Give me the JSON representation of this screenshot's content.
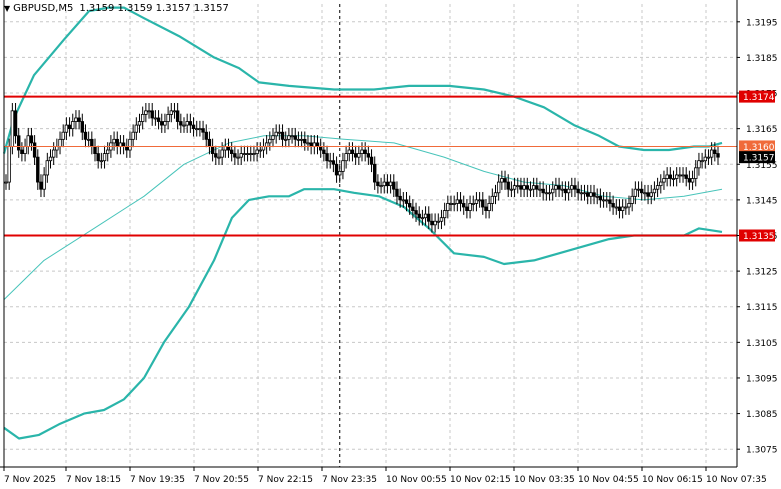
{
  "header": {
    "symbol": "GBPUSD,M5",
    "ohlc": "1.3159 1.3159 1.3157 1.3157"
  },
  "colors": {
    "background": "#ffffff",
    "grid": "#c8c8c8",
    "bollinger": "#2ab5aa",
    "middle_band": "#48c4ba",
    "level_strong": "#e00000",
    "level_thin": "#f06a3a",
    "candle": "#000000",
    "price_badge": "#000000"
  },
  "chart_data": {
    "type": "candlestick",
    "ylim": [
      1.307,
      1.32
    ],
    "y_ticks": [
      "1.3195",
      "1.3185",
      "1.3175",
      "1.3165",
      "1.3155",
      "1.3145",
      "1.3135",
      "1.3125",
      "1.3115",
      "1.3105",
      "1.3095",
      "1.3085",
      "1.3075"
    ],
    "x_ticks": [
      "7 Nov 2025",
      "7 Nov 18:15",
      "7 Nov 19:35",
      "7 Nov 20:55",
      "7 Nov 22:15",
      "7 Nov 23:35",
      "10 Nov 00:55",
      "10 Nov 02:15",
      "10 Nov 03:35",
      "10 Nov 04:55",
      "10 Nov 06:15",
      "10 Nov 07:35"
    ],
    "levels": [
      {
        "value": 1.3174,
        "label": "1.3174",
        "style": "strong"
      },
      {
        "value": 1.316,
        "label": "1.3160",
        "style": "thin"
      },
      {
        "value": 1.3135,
        "label": "1.3135",
        "style": "strong"
      }
    ],
    "current_price": {
      "value": 1.3157,
      "label": "1.3157"
    },
    "session_break_index": 105,
    "closes": [
      1.315,
      1.316,
      1.317,
      1.3163,
      1.3159,
      1.3158,
      1.316,
      1.3163,
      1.3161,
      1.3157,
      1.315,
      1.3148,
      1.3152,
      1.3156,
      1.3157,
      1.3159,
      1.316,
      1.3162,
      1.3164,
      1.3166,
      1.3165,
      1.3167,
      1.3168,
      1.3167,
      1.3164,
      1.3162,
      1.3162,
      1.316,
      1.3158,
      1.3156,
      1.3156,
      1.3158,
      1.3159,
      1.3161,
      1.3162,
      1.316,
      1.3161,
      1.316,
      1.3159,
      1.3162,
      1.3164,
      1.3166,
      1.3167,
      1.3169,
      1.317,
      1.317,
      1.3168,
      1.3168,
      1.3167,
      1.3166,
      1.3167,
      1.3169,
      1.317,
      1.317,
      1.3167,
      1.3166,
      1.3166,
      1.3167,
      1.3166,
      1.3165,
      1.3165,
      1.3165,
      1.3164,
      1.3162,
      1.316,
      1.3158,
      1.3157,
      1.3157,
      1.3159,
      1.316,
      1.3159,
      1.3158,
      1.3157,
      1.3157,
      1.3158,
      1.3158,
      1.3158,
      1.3158,
      1.3158,
      1.3159,
      1.3159,
      1.316,
      1.3161,
      1.3162,
      1.3163,
      1.3164,
      1.3164,
      1.3162,
      1.3162,
      1.3163,
      1.3163,
      1.3162,
      1.3162,
      1.3162,
      1.3161,
      1.3161,
      1.316,
      1.3161,
      1.316,
      1.3159,
      1.3158,
      1.3156,
      1.3156,
      1.3155,
      1.3152,
      1.3153,
      1.3156,
      1.3158,
      1.3159,
      1.3158,
      1.3157,
      1.3158,
      1.3159,
      1.3158,
      1.3157,
      1.3155,
      1.315,
      1.3149,
      1.3149,
      1.315,
      1.3149,
      1.315,
      1.3148,
      1.3146,
      1.3145,
      1.3145,
      1.3144,
      1.3143,
      1.3142,
      1.3141,
      1.314,
      1.314,
      1.3141,
      1.3139,
      1.3138,
      1.3139,
      1.3139,
      1.314,
      1.3142,
      1.3144,
      1.3144,
      1.3144,
      1.3145,
      1.3144,
      1.3143,
      1.3142,
      1.3144,
      1.3144,
      1.3145,
      1.3145,
      1.3143,
      1.3142,
      1.3144,
      1.3146,
      1.3147,
      1.315,
      1.3151,
      1.315,
      1.3148,
      1.3148,
      1.3149,
      1.3149,
      1.3148,
      1.3149,
      1.3148,
      1.3148,
      1.3149,
      1.3148,
      1.3148,
      1.3147,
      1.3147,
      1.3147,
      1.3148,
      1.3149,
      1.3148,
      1.3148,
      1.3147,
      1.3148,
      1.3149,
      1.3148,
      1.3147,
      1.3147,
      1.3147,
      1.3146,
      1.3147,
      1.3146,
      1.3146,
      1.3145,
      1.3145,
      1.3145,
      1.3144,
      1.3143,
      1.3143,
      1.3142,
      1.3143,
      1.3143,
      1.3144,
      1.3146,
      1.3148,
      1.3148,
      1.3147,
      1.3147,
      1.3146,
      1.3147,
      1.3148,
      1.3149,
      1.315,
      1.3151,
      1.3152,
      1.3151,
      1.3151,
      1.3152,
      1.3152,
      1.3152,
      1.3151,
      1.315,
      1.3151,
      1.3154,
      1.3156,
      1.3156,
      1.3157,
      1.3157,
      1.3159,
      1.3158,
      1.3157
    ],
    "upper_band": [
      [
        0,
        1.3158
      ],
      [
        10,
        1.3168
      ],
      [
        30,
        1.318
      ],
      [
        60,
        1.319
      ],
      [
        85,
        1.3198
      ],
      [
        105,
        1.3199
      ],
      [
        120,
        1.3199
      ],
      [
        140,
        1.3196
      ],
      [
        175,
        1.3191
      ],
      [
        210,
        1.3185
      ],
      [
        235,
        1.3182
      ],
      [
        255,
        1.3178
      ],
      [
        285,
        1.3177
      ],
      [
        330,
        1.3176
      ],
      [
        370,
        1.3176
      ],
      [
        405,
        1.3177
      ],
      [
        445,
        1.3177
      ],
      [
        480,
        1.3176
      ],
      [
        510,
        1.3174
      ],
      [
        540,
        1.3171
      ],
      [
        570,
        1.3166
      ],
      [
        595,
        1.3163
      ],
      [
        615,
        1.316
      ],
      [
        640,
        1.3159
      ],
      [
        665,
        1.3159
      ],
      [
        690,
        1.316
      ],
      [
        705,
        1.316
      ],
      [
        718,
        1.3161
      ]
    ],
    "middle_band": [
      [
        0,
        1.3117
      ],
      [
        40,
        1.3128
      ],
      [
        90,
        1.3137
      ],
      [
        140,
        1.3146
      ],
      [
        180,
        1.3155
      ],
      [
        225,
        1.3161
      ],
      [
        260,
        1.3163
      ],
      [
        300,
        1.3163
      ],
      [
        340,
        1.3162
      ],
      [
        390,
        1.3161
      ],
      [
        440,
        1.3157
      ],
      [
        480,
        1.3153
      ],
      [
        520,
        1.315
      ],
      [
        560,
        1.3149
      ],
      [
        600,
        1.3146
      ],
      [
        640,
        1.3145
      ],
      [
        680,
        1.3146
      ],
      [
        718,
        1.3148
      ]
    ],
    "lower_band": [
      [
        0,
        1.3081
      ],
      [
        15,
        1.3078
      ],
      [
        35,
        1.3079
      ],
      [
        55,
        1.3082
      ],
      [
        80,
        1.3085
      ],
      [
        100,
        1.3086
      ],
      [
        120,
        1.3089
      ],
      [
        140,
        1.3095
      ],
      [
        160,
        1.3105
      ],
      [
        185,
        1.3115
      ],
      [
        210,
        1.3128
      ],
      [
        228,
        1.314
      ],
      [
        245,
        1.3145
      ],
      [
        265,
        1.3146
      ],
      [
        285,
        1.3146
      ],
      [
        300,
        1.3148
      ],
      [
        330,
        1.3148
      ],
      [
        350,
        1.3147
      ],
      [
        375,
        1.3146
      ],
      [
        400,
        1.3143
      ],
      [
        425,
        1.3137
      ],
      [
        450,
        1.313
      ],
      [
        480,
        1.3129
      ],
      [
        500,
        1.3127
      ],
      [
        530,
        1.3128
      ],
      [
        555,
        1.313
      ],
      [
        580,
        1.3132
      ],
      [
        605,
        1.3134
      ],
      [
        630,
        1.3135
      ],
      [
        660,
        1.3135
      ],
      [
        680,
        1.3135
      ],
      [
        695,
        1.3137
      ],
      [
        718,
        1.3136
      ]
    ]
  }
}
